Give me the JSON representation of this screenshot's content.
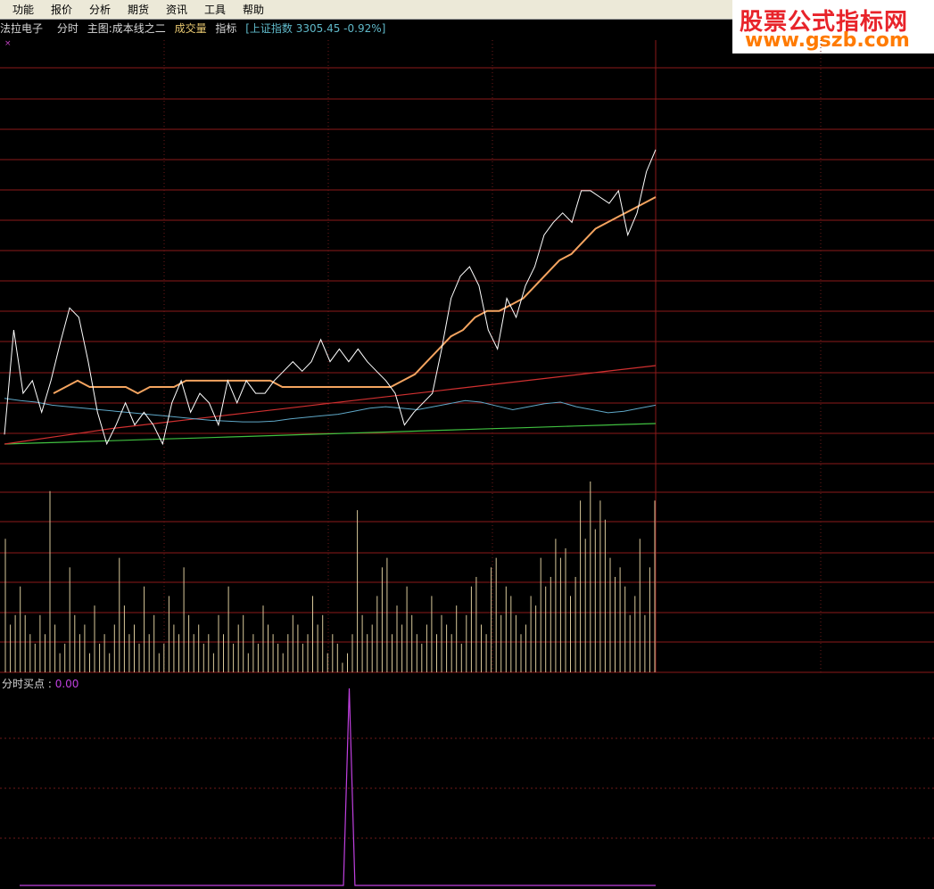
{
  "menu": {
    "items": [
      {
        "label": "功能"
      },
      {
        "label": "报价"
      },
      {
        "label": "分析"
      },
      {
        "label": "期货"
      },
      {
        "label": "资讯"
      },
      {
        "label": "工具"
      },
      {
        "label": "帮助"
      }
    ]
  },
  "watermark": {
    "line1": "股票公式指标网",
    "line2": "www.gszb.com"
  },
  "infobar": {
    "stock_name": "法拉电子",
    "view": "分时",
    "main_chart": "主图:成本线之二",
    "volume": "成交量",
    "indicator": "指标",
    "index_label": "[上证指数 3305.45 -0.92%]"
  },
  "close_glyph": "×",
  "sub_indicator": {
    "name": "分时买点",
    "separator": " : ",
    "value": "0.00"
  },
  "colors": {
    "grid": "#8b1a1a",
    "grid_dotted": "#6e1a1a",
    "price": "#ffffff",
    "avg_cost": "#f4a460",
    "blue_line": "#5fa8c8",
    "red_line": "#d03030",
    "green_line": "#40c040",
    "volume_bar": "#d8c89a",
    "signal": "#c040e0"
  },
  "chart_data": {
    "type": "line",
    "title": "",
    "series": [
      {
        "values": [
          0.95,
          0.62,
          0.82,
          0.78,
          0.88,
          0.78,
          0.66,
          0.55,
          0.58,
          0.72,
          0.88,
          0.98,
          0.92,
          0.85,
          0.92,
          0.88,
          0.92,
          0.98,
          0.85,
          0.78,
          0.88,
          0.82,
          0.85,
          0.92,
          0.78,
          0.85,
          0.78,
          0.82,
          0.82,
          0.78,
          0.75,
          0.72,
          0.75,
          0.72,
          0.65,
          0.72,
          0.68,
          0.72,
          0.68,
          0.72,
          0.75,
          0.78,
          0.82,
          0.92,
          0.88,
          0.85,
          0.82,
          0.68,
          0.52,
          0.45,
          0.42,
          0.48,
          0.62,
          0.68,
          0.52,
          0.58,
          0.48,
          0.42,
          0.32,
          0.28,
          0.25,
          0.28,
          0.18,
          0.18,
          0.2,
          0.22,
          0.18,
          0.32,
          0.25,
          0.12,
          0.05
        ]
      },
      {
        "values": [
          0.82,
          0.8,
          0.78,
          0.8,
          0.8,
          0.8,
          0.8,
          0.82,
          0.8,
          0.8,
          0.8,
          0.78,
          0.78,
          0.78,
          0.78,
          0.78,
          0.78,
          0.78,
          0.78,
          0.8,
          0.8,
          0.8,
          0.8,
          0.8,
          0.8,
          0.8,
          0.8,
          0.8,
          0.8,
          0.78,
          0.76,
          0.72,
          0.68,
          0.64,
          0.62,
          0.58,
          0.56,
          0.56,
          0.54,
          0.52,
          0.48,
          0.44,
          0.4,
          0.38,
          0.34,
          0.3,
          0.28,
          0.26,
          0.24,
          0.22,
          0.2
        ]
      },
      {
        "values": [
          0.55,
          0.58,
          0.6,
          0.64,
          0.66,
          0.68,
          0.7,
          0.72,
          0.74,
          0.76,
          0.78,
          0.8,
          0.82,
          0.84,
          0.85,
          0.86,
          0.86,
          0.85,
          0.82,
          0.8,
          0.78,
          0.76,
          0.72,
          0.68,
          0.66,
          0.68,
          0.7,
          0.66,
          0.62,
          0.58,
          0.6,
          0.65,
          0.7,
          0.66,
          0.62,
          0.6,
          0.66,
          0.7,
          0.74,
          0.72,
          0.68,
          0.64
        ]
      },
      {
        "values": [
          1.0,
          0.95,
          0.9,
          0.85,
          0.8,
          0.76,
          0.72,
          0.68,
          0.64,
          0.6,
          0.56,
          0.52,
          0.48,
          0.44,
          0.4,
          0.36,
          0.32,
          0.28,
          0.24,
          0.2,
          0.16,
          0.12,
          0.08,
          0.04,
          0.0
        ]
      },
      {
        "values": [
          1.0,
          0.97,
          0.94,
          0.91,
          0.88,
          0.85,
          0.82,
          0.79,
          0.76,
          0.73,
          0.7,
          0.67,
          0.64,
          0.61,
          0.58,
          0.55,
          0.52,
          0.49,
          0.46,
          0.43,
          0.4,
          0.37,
          0.34,
          0.31,
          0.28
        ]
      },
      {
        "values": [
          0.7,
          0.25,
          0.3,
          0.45,
          0.3,
          0.2,
          0.15,
          0.3,
          0.2,
          0.95,
          0.25,
          0.1,
          0.15,
          0.55,
          0.3,
          0.2,
          0.25,
          0.1,
          0.35,
          0.15,
          0.2,
          0.1,
          0.25,
          0.6,
          0.35,
          0.2,
          0.25,
          0.15,
          0.45,
          0.2,
          0.3,
          0.1,
          0.15,
          0.4,
          0.25,
          0.2,
          0.55,
          0.3,
          0.2,
          0.25,
          0.15,
          0.2,
          0.1,
          0.3,
          0.2,
          0.45,
          0.15,
          0.25,
          0.3,
          0.1,
          0.2,
          0.15,
          0.35,
          0.25,
          0.2,
          0.15,
          0.1,
          0.2,
          0.3,
          0.25,
          0.15,
          0.2,
          0.4,
          0.25,
          0.3,
          0.1,
          0.2,
          0.15,
          0.05,
          0.1,
          0.2,
          0.85,
          0.3,
          0.2,
          0.25,
          0.4,
          0.55,
          0.6,
          0.2,
          0.35,
          0.25,
          0.45,
          0.3,
          0.2,
          0.15,
          0.25,
          0.4,
          0.2,
          0.3,
          0.25,
          0.2,
          0.35,
          0.15,
          0.3,
          0.45,
          0.5,
          0.25,
          0.2,
          0.55,
          0.6,
          0.3,
          0.45,
          0.4,
          0.3,
          0.2,
          0.25,
          0.4,
          0.35,
          0.6,
          0.45,
          0.5,
          0.7,
          0.6,
          0.65,
          0.4,
          0.5,
          0.9,
          0.7,
          1.0,
          0.75,
          0.9,
          0.8,
          0.6,
          0.5,
          0.55,
          0.45,
          0.3,
          0.4,
          0.7,
          0.3,
          0.55,
          0.9
        ]
      },
      {
        "values": [
          0,
          0,
          0,
          0,
          0,
          0,
          0,
          0,
          0,
          0,
          0,
          0,
          0,
          0,
          0,
          0,
          0,
          0,
          0,
          0,
          0,
          0,
          0,
          0,
          0,
          0,
          0,
          0,
          0,
          0,
          0,
          0,
          0,
          0,
          0,
          0,
          0,
          0,
          0,
          0,
          0,
          0,
          0,
          0,
          0,
          0,
          0,
          0,
          0,
          0,
          0,
          0,
          0,
          0,
          0,
          0,
          0,
          1,
          0,
          0,
          0,
          0,
          0,
          0,
          0,
          0,
          0,
          0,
          0,
          0,
          0,
          0,
          0,
          0,
          0,
          0,
          0,
          0,
          0,
          0,
          0,
          0,
          0,
          0,
          0,
          0,
          0,
          0,
          0,
          0,
          0,
          0,
          0,
          0,
          0,
          0,
          0,
          0,
          0,
          0,
          0,
          0,
          0,
          0,
          0,
          0,
          0,
          0,
          0,
          0,
          0
        ]
      }
    ]
  }
}
